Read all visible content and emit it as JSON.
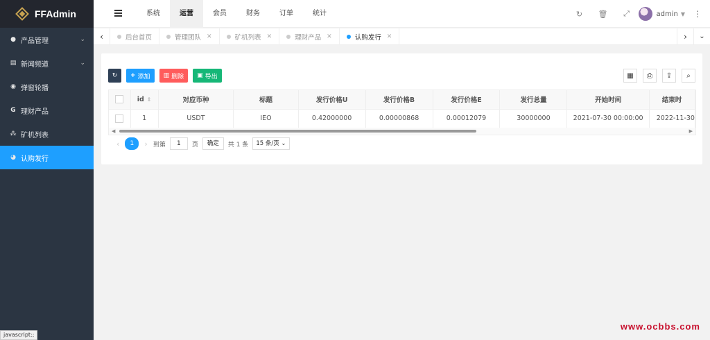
{
  "app": {
    "name": "FFAdmin"
  },
  "sidebar": {
    "items": [
      {
        "label": "产品管理",
        "icon": "circle-p-icon",
        "expandable": true
      },
      {
        "label": "新闻频道",
        "icon": "keyboard-icon",
        "expandable": true
      },
      {
        "label": "弹窗轮播",
        "icon": "play-circle-icon",
        "expandable": false
      },
      {
        "label": "理财产品",
        "icon": "g-letter-icon",
        "expandable": false
      },
      {
        "label": "矿机列表",
        "icon": "cubes-icon",
        "expandable": false
      },
      {
        "label": "认购发行",
        "icon": "pie-chart-icon",
        "expandable": false,
        "active": true
      }
    ]
  },
  "header": {
    "nav": [
      "系统",
      "运营",
      "会员",
      "财务",
      "订单",
      "统计"
    ],
    "active_nav": "运营",
    "user": "admin"
  },
  "tabs": {
    "items": [
      {
        "label": "后台首页",
        "closable": false
      },
      {
        "label": "管理团队",
        "closable": true
      },
      {
        "label": "矿机列表",
        "closable": true
      },
      {
        "label": "理财产品",
        "closable": true
      },
      {
        "label": "认购发行",
        "closable": true,
        "active": true
      }
    ]
  },
  "toolbar": {
    "add": "添加",
    "delete": "删除",
    "export": "导出"
  },
  "table": {
    "columns": [
      "id",
      "对应币种",
      "标题",
      "发行价格U",
      "发行价格B",
      "发行价格E",
      "发行总量",
      "开始时间",
      "结束时"
    ],
    "rows": [
      [
        "1",
        "USDT",
        "IEO",
        "0.42000000",
        "0.00000868",
        "0.00012079",
        "30000000",
        "2021-07-30 00:00:00",
        "2022-11-30"
      ]
    ]
  },
  "pager": {
    "current": "1",
    "goto_prefix": "到第",
    "goto_value": "1",
    "goto_suffix": "页",
    "confirm": "确定",
    "total": "共 1 条",
    "page_size": "15 条/页"
  },
  "status_bar": "javascript:;",
  "watermark": "www.ocbbs.com",
  "colors": {
    "sidebar": "#2b3542",
    "accent": "#1e9fff",
    "danger": "#ff5c5c",
    "success": "#16b777"
  }
}
